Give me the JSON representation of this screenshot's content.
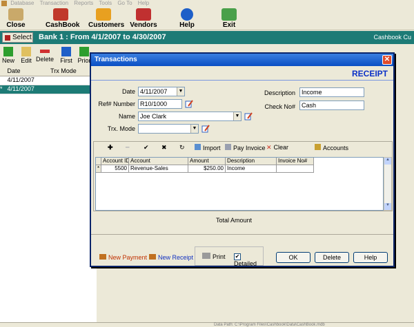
{
  "menubar": {
    "items": [
      "Database",
      "Transaction",
      "Reports",
      "Tools",
      "Go To",
      "Help"
    ]
  },
  "toolbar": {
    "close": "Close",
    "cashbook": "CashBook",
    "customers": "Customers",
    "vendors": "Vendors",
    "help": "Help",
    "exit": "Exit"
  },
  "bankbar": {
    "select": "Select",
    "title": "Bank 1 :  From  4/1/2007  to  4/30/2007",
    "right": "Cashbook Cu"
  },
  "nav": {
    "new": "New",
    "edit": "Edit",
    "delete": "Delete",
    "first": "First",
    "prior": "Prior"
  },
  "grid": {
    "col_date": "Date",
    "col_trx": "Trx Mode",
    "rows": [
      {
        "date": "4/11/2007"
      },
      {
        "date": "4/11/2007"
      }
    ]
  },
  "dialog": {
    "title": "Transactions",
    "mode": "RECEIPT",
    "date_label": "Date",
    "date": "4/11/2007",
    "ref_label": "Ref# Number",
    "ref": "R10/1000",
    "name_label": "Name",
    "name": "Joe Clark",
    "trx_label": "Trx. Mode",
    "trx": "",
    "desc_label": "Description",
    "desc": "Income",
    "check_label": "Check No#",
    "check": "Cash",
    "tools": {
      "import": "Import",
      "pay_invoice": "Pay Invoice",
      "clear": "Clear",
      "accounts": "Accounts"
    },
    "table": {
      "headers": [
        "Account ID",
        "Account",
        "Amount",
        "Description",
        "Invoice No#"
      ],
      "rows": [
        [
          "5500",
          "Revenue-Sales",
          "$250.00",
          "Income",
          ""
        ]
      ]
    },
    "total_label": "Total Amount",
    "new_payment": "New Payment",
    "new_receipt": "New Receipt",
    "print": "Print",
    "detailed": "Detailed",
    "ok": "OK",
    "delete": "Delete",
    "help": "Help"
  },
  "statusbar": "Data Path: C:\\Program Files\\Cashbook\\Data\\CashBook.mdb"
}
